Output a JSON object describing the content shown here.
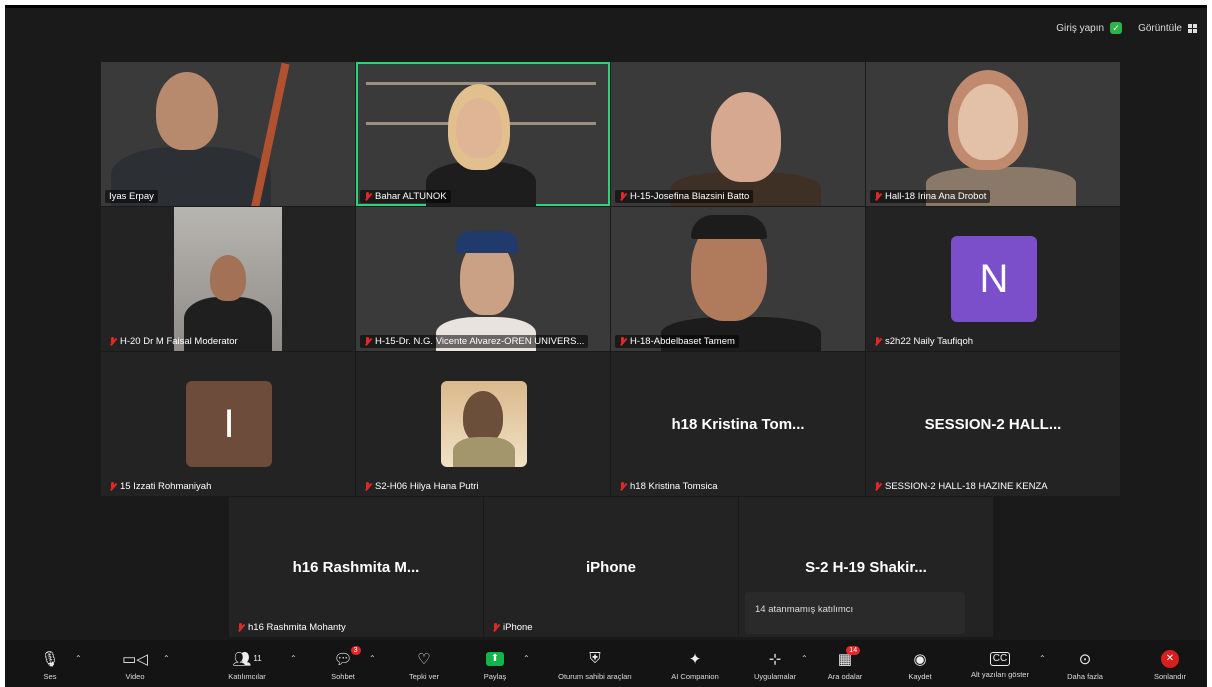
{
  "topbar": {
    "signin_label": "Giriş yapın",
    "view_label": "Görüntüle"
  },
  "tiles": {
    "t1": "Iyas Erpay",
    "t2": "Bahar ALTUNOK",
    "t3": "H-15-Josefina Blazsini Batto",
    "t4": "Hall-18 Irina Ana Drobot",
    "t5": "H-20 Dr M Faisal Moderator",
    "t6": "H-15-Dr. N.G. Vicente Alvarez-OREN UNIVERS...",
    "t7": "H-18-Abdelbaset Tamem",
    "t8": "s2h22 Naily Taufiqoh",
    "t9": "15 Izzati Rohmaniyah",
    "t10": "S2-H06 Hilya Hana Putri",
    "t11": "h18 Kristina Tomsica",
    "t12": "SESSION-2 HALL-18 HAZINE KENZA",
    "t13": "h16 Rashmita Mohanty",
    "t14": "iPhone"
  },
  "big_names": {
    "t11": "h18 Kristina Tom...",
    "t12": "SESSION-2  HALL...",
    "t13": "h16 Rashmita M...",
    "t14": "iPhone",
    "t15": "S-2 H-19 Shakir..."
  },
  "avatars": {
    "t8": "N",
    "t9": "I"
  },
  "colors": {
    "avatar_n": "#7a4fc9",
    "avatar_i": "#6d4c3c",
    "active_border": "#2bd47b",
    "share": "#12b54a",
    "end": "#d62020"
  },
  "unassigned_label": "14 atanmamış katılımcı",
  "toolbar": {
    "audio": "Ses",
    "video": "Video",
    "participants": "Katılımcılar",
    "participants_count": "11",
    "chat": "Sohbet",
    "chat_badge": "3",
    "react": "Tepki ver",
    "share": "Paylaş",
    "host_tools": "Oturum sahibi araçları",
    "ai": "AI Companion",
    "apps": "Uygulamalar",
    "breakout": "Ara odalar",
    "breakout_badge": "14",
    "record": "Kaydet",
    "captions": "Alt yazıları göster",
    "more": "Daha fazla",
    "end": "Sonlandır"
  },
  "icons": [
    "mic-icon",
    "camera-icon",
    "participants-icon",
    "chat-icon",
    "heart-icon",
    "share-icon",
    "shield-icon",
    "sparkle-icon",
    "apps-icon",
    "breakout-icon",
    "record-icon",
    "cc-icon",
    "more-icon",
    "end-icon"
  ]
}
